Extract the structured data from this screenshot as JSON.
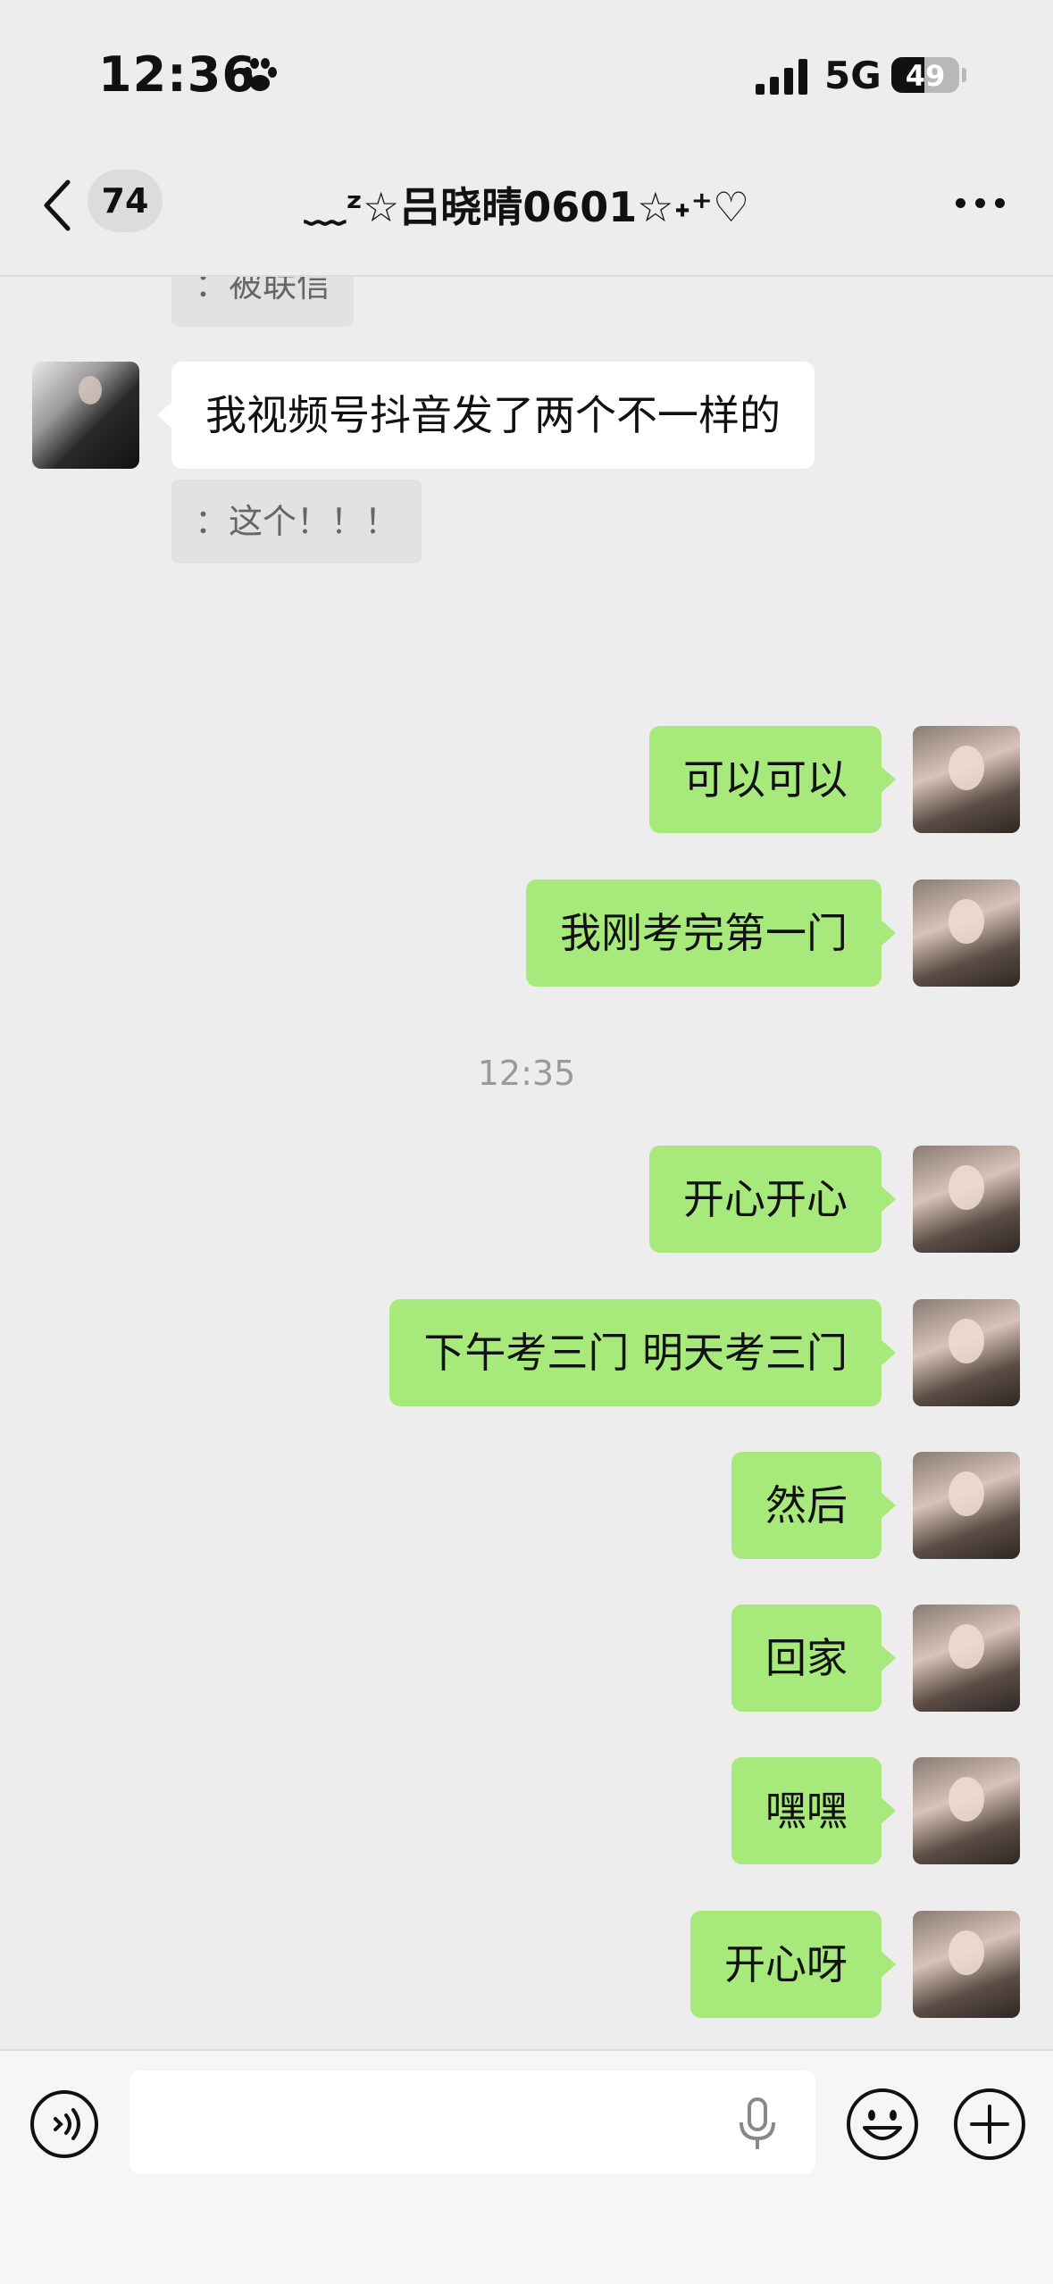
{
  "status_bar": {
    "time": "12:36",
    "network": "5G",
    "battery_level": "49",
    "battery_fraction": 0.49
  },
  "nav": {
    "unread_count": "74",
    "title": "﹏ᶻ☆吕晓晴0601☆˖⁺♡"
  },
  "messages": {
    "quote_top": "：被联信",
    "peer_message": "我视频号抖音发了两个不一样的",
    "peer_quote": "：这个！！！",
    "me_1": "可以可以",
    "me_2": "我刚考完第一门",
    "timestamp": "12:35",
    "me_3": "开心开心",
    "me_4": "下午考三门 明天考三门",
    "me_5": "然后",
    "me_6": "回家",
    "me_7": "嘿嘿",
    "me_8": "开心呀"
  },
  "input": {
    "value": "",
    "placeholder": ""
  },
  "colors": {
    "background": "#ededed",
    "outgoing_bubble": "#a8e97c",
    "incoming_bubble": "#ffffff"
  },
  "icons": [
    "paw-icon",
    "signal-icon",
    "back-icon",
    "more-icon",
    "voice-icon",
    "mic-icon",
    "emoji-icon",
    "plus-icon"
  ]
}
